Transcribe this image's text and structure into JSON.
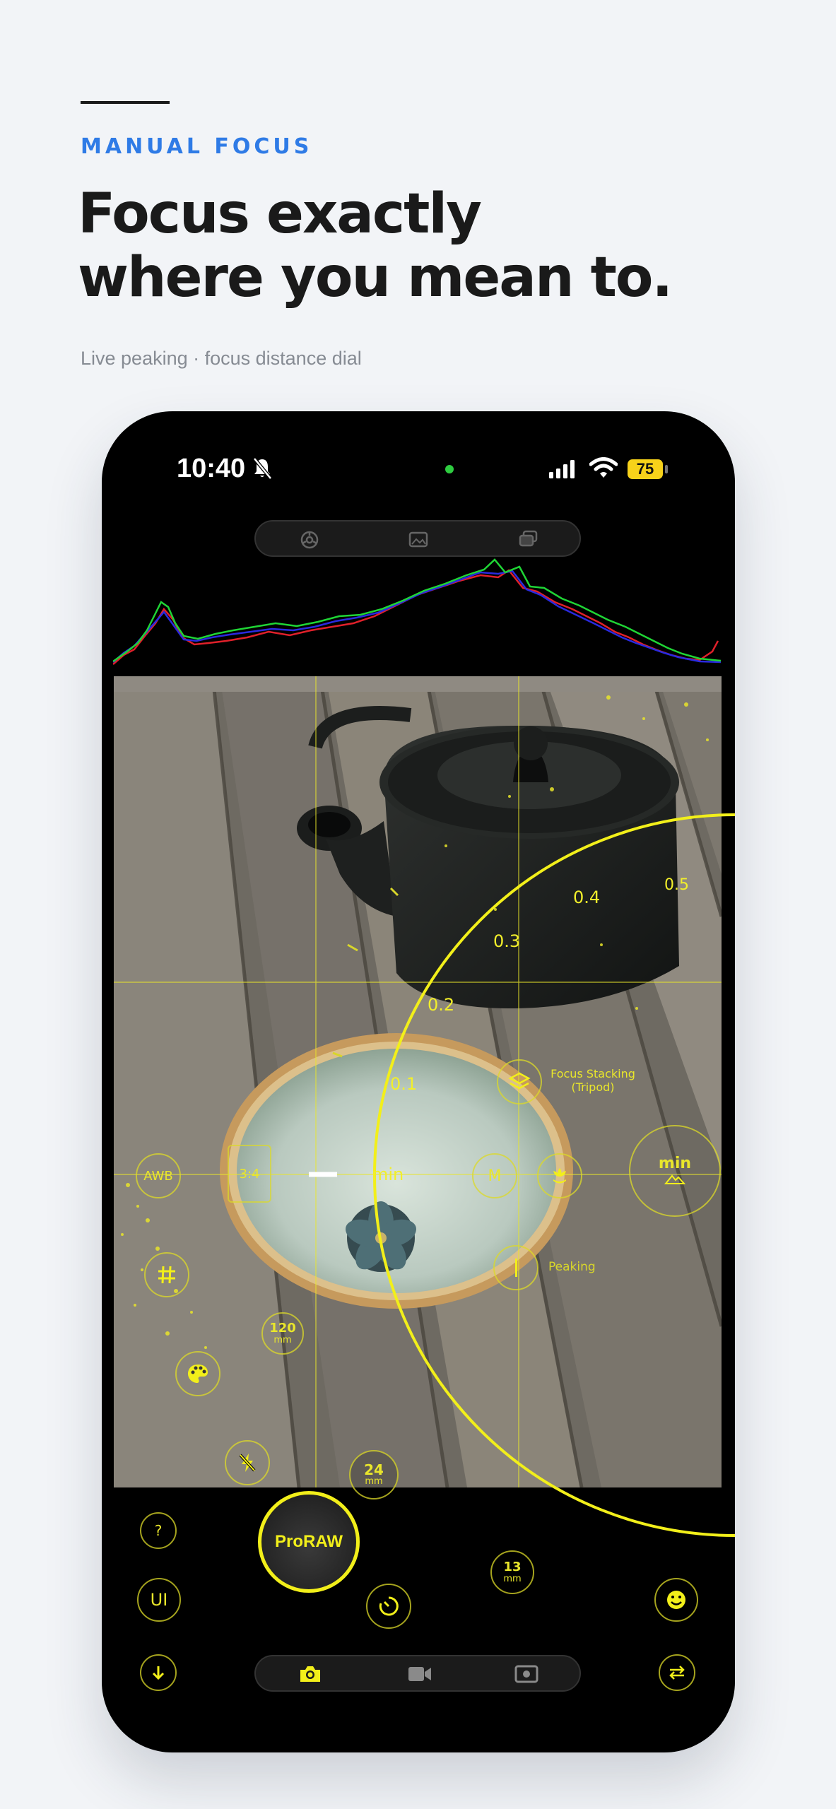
{
  "header": {
    "eyebrow": "MANUAL FOCUS",
    "headline_line1": "Focus exactly",
    "headline_line2": "where you mean to.",
    "subtitle": "Live peaking · focus distance dial"
  },
  "status_bar": {
    "time": "10:40",
    "battery": "75"
  },
  "focus_dial": {
    "ticks": [
      "0.1",
      "0.2",
      "0.3",
      "0.4",
      "0.5"
    ],
    "min_label": "min"
  },
  "overlay_controls": {
    "awb": "AWB",
    "aspect": "3:4",
    "manual": "M",
    "focus_stacking_line1": "Focus Stacking",
    "focus_stacking_line2": "(Tripod)",
    "peaking": "Peaking",
    "focus_min": "min",
    "lens_120": "120",
    "lens_24": "24",
    "lens_13": "13",
    "lens_unit": "mm"
  },
  "bottom_controls": {
    "help": "?",
    "ui": "UI",
    "shutter": "ProRAW"
  },
  "colors": {
    "accent_yellow": "#f2ef1a",
    "eyebrow_blue": "#2f7be6",
    "background": "#f2f4f7"
  }
}
